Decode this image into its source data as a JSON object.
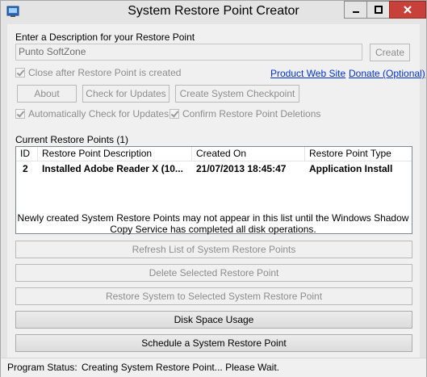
{
  "window": {
    "title": "System Restore Point Creator"
  },
  "description": {
    "label": "Enter a Description for your Restore Point",
    "value": "Punto SoftZone",
    "create_label": "Create"
  },
  "options": {
    "close_after_label": "Close after Restore Point is created",
    "auto_check_label": "Automatically Check for Updates",
    "confirm_deletions_label": "Confirm Restore Point Deletions"
  },
  "links": {
    "product_web_site": "Product Web Site",
    "donate": "Donate (Optional)"
  },
  "buttons": {
    "about": "About",
    "check_updates": "Check for Updates",
    "create_checkpoint": "Create System Checkpoint",
    "refresh": "Refresh List of System Restore Points",
    "delete_selected": "Delete Selected Restore Point",
    "restore_selected": "Restore System to Selected System Restore Point",
    "disk_space": "Disk Space Usage",
    "schedule": "Schedule a System Restore Point"
  },
  "list": {
    "heading": "Current Restore Points (1)",
    "columns": [
      "ID",
      "Restore Point Description",
      "Created On",
      "Restore Point Type"
    ],
    "rows": [
      [
        "2",
        "Installed Adobe Reader X (10...",
        "21/07/2013 18:45:47",
        "Application Install"
      ]
    ]
  },
  "note": "Newly created System Restore Points may not appear in this list until the Windows Shadow Copy Service has completed all disk operations.",
  "status": {
    "label": "Program Status:",
    "value": "Creating System Restore Point... Please Wait."
  },
  "colors": {
    "close_button": "#c7413a",
    "link": "#0033cc"
  },
  "icons": [
    "app-icon",
    "minimize-icon",
    "maximize-icon",
    "close-icon",
    "checkbox-checked-icon"
  ]
}
